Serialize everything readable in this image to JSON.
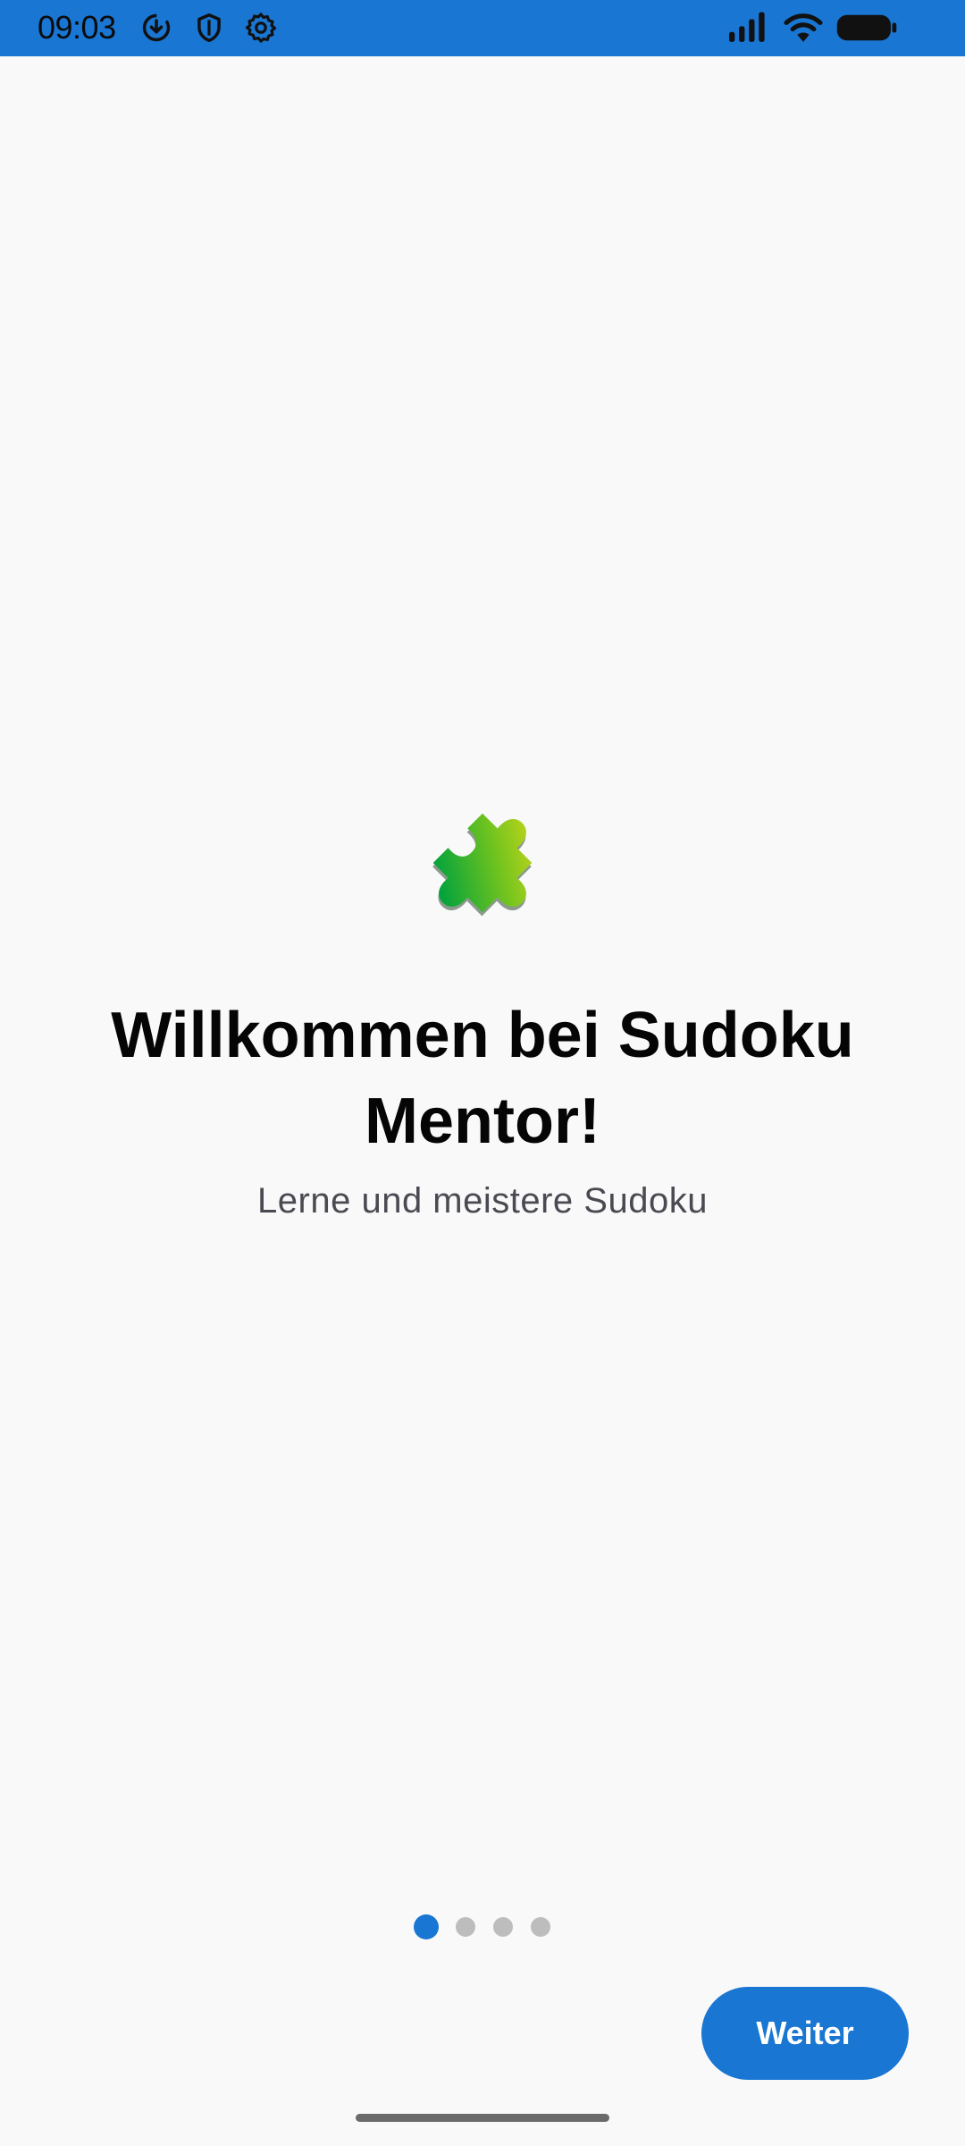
{
  "status_bar": {
    "time": "09:03",
    "left_icons": [
      "download-icon",
      "shield-icon",
      "gear-icon"
    ],
    "right_icons": [
      "signal-icon",
      "wifi-icon",
      "battery-icon"
    ],
    "background": "#1976d2"
  },
  "welcome": {
    "logo_icon": "puzzle-piece-icon",
    "title": "Willkommen bei Sudoku Mentor!",
    "subtitle": "Lerne und meistere Sudoku"
  },
  "pager": {
    "total_pages": 4,
    "active_page": 1,
    "active_color": "#1976d2",
    "inactive_color": "#bdbdbd"
  },
  "actions": {
    "next_label": "Weiter"
  },
  "colors": {
    "accent": "#1976d2",
    "background": "#f9f9f9",
    "puzzle_light": "#b5d31a",
    "puzzle_dark": "#0aa23a"
  }
}
